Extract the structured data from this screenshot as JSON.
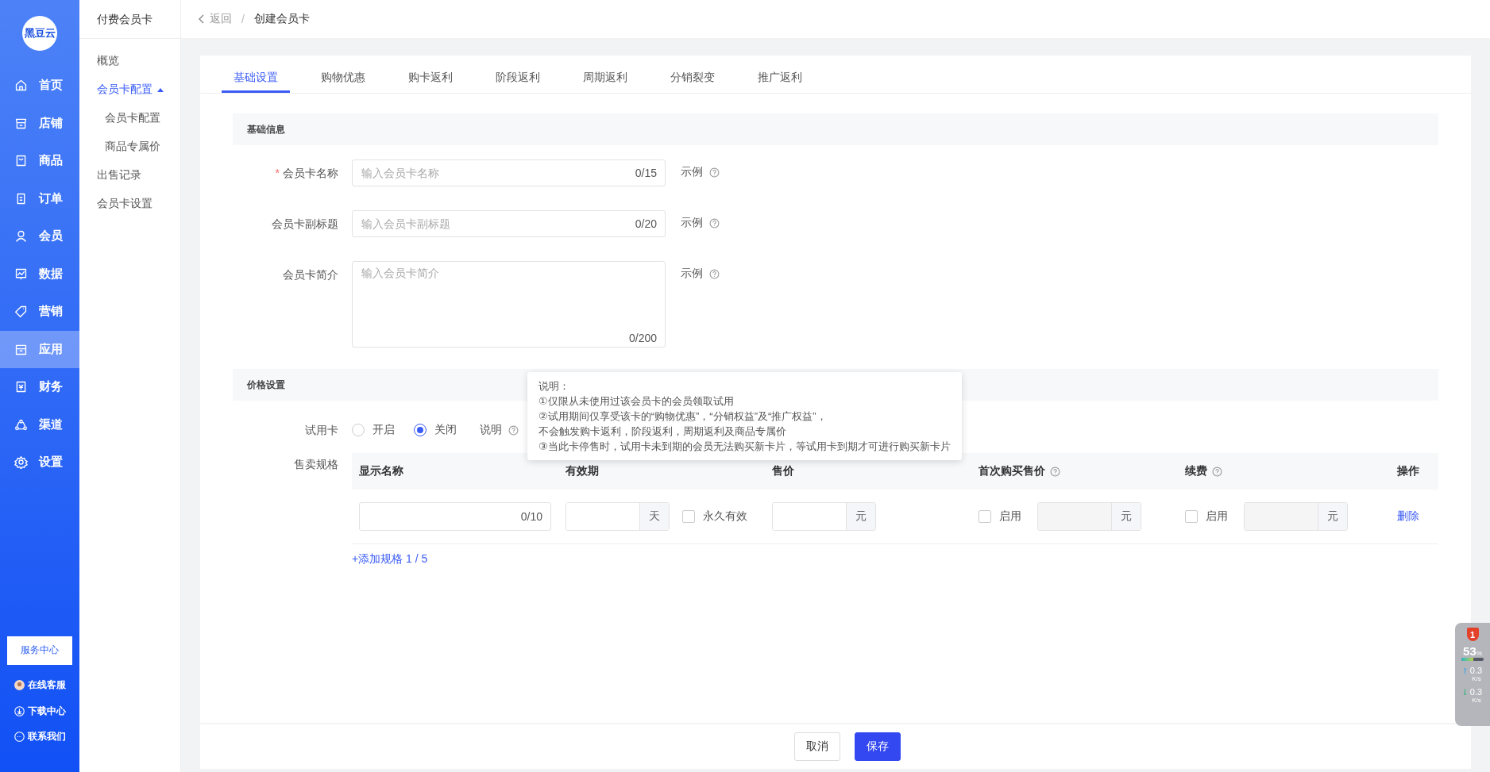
{
  "sidebar": {
    "logo": "黑豆云",
    "items": [
      {
        "label": "首页",
        "selected": false
      },
      {
        "label": "店铺",
        "selected": false
      },
      {
        "label": "商品",
        "selected": false
      },
      {
        "label": "订单",
        "selected": false
      },
      {
        "label": "会员",
        "selected": false
      },
      {
        "label": "数据",
        "selected": false
      },
      {
        "label": "营销",
        "selected": false
      },
      {
        "label": "应用",
        "selected": true
      },
      {
        "label": "财务",
        "selected": false
      },
      {
        "label": "渠道",
        "selected": false
      },
      {
        "label": "设置",
        "selected": false
      }
    ],
    "service_button": "服务中心",
    "links": [
      "在线客服",
      "下载中心",
      "联系我们"
    ]
  },
  "subnav": {
    "title": "付费会员卡",
    "items": [
      {
        "label": "概览",
        "selected": false
      },
      {
        "label": "会员卡配置",
        "selected": true,
        "expanded": true,
        "children": [
          {
            "label": "会员卡配置",
            "selected": false
          },
          {
            "label": "商品专属价",
            "selected": false
          }
        ]
      },
      {
        "label": "出售记录",
        "selected": false
      },
      {
        "label": "会员卡设置",
        "selected": false
      }
    ]
  },
  "breadcrumb": {
    "back": "返回",
    "separator": "/",
    "current": "创建会员卡"
  },
  "tabs": [
    {
      "label": "基础设置",
      "selected": true
    },
    {
      "label": "购物优惠",
      "selected": false
    },
    {
      "label": "购卡返利",
      "selected": false
    },
    {
      "label": "阶段返利",
      "selected": false
    },
    {
      "label": "周期返利",
      "selected": false
    },
    {
      "label": "分销裂变",
      "selected": false
    },
    {
      "label": "推广返利",
      "selected": false
    }
  ],
  "basic_info": {
    "title": "基础信息",
    "required_mark": "*",
    "fields": [
      {
        "kind": "input",
        "label": "会员卡名称",
        "required": true,
        "placeholder": "输入会员卡名称",
        "counter": "0/15",
        "example": "示例"
      },
      {
        "kind": "input",
        "label": "会员卡副标题",
        "required": false,
        "placeholder": "输入会员卡副标题",
        "counter": "0/20",
        "example": "示例"
      },
      {
        "kind": "textarea",
        "label": "会员卡简介",
        "required": false,
        "placeholder": "输入会员卡简介",
        "counter": "0/200",
        "example": "示例"
      }
    ]
  },
  "price": {
    "title": "价格设置",
    "trial": {
      "label": "试用卡",
      "options": [
        {
          "label": "开启",
          "selected": false
        },
        {
          "label": "关闭",
          "selected": true
        }
      ],
      "note": "说明"
    },
    "tooltip": {
      "title": "说明：",
      "lines": [
        "①仅限从未使用过该会员卡的会员领取试用",
        "②试用期间仅享受该卡的“购物优惠”，“分销权益”及“推广权益”，",
        "不会触发购卡返利，阶段返利，周期返利及商品专属价",
        "③当此卡停售时，试用卡未到期的会员无法购买新卡片，等试用卡到期才可进行购买新卡片"
      ]
    },
    "spec": {
      "label": "售卖规格",
      "columns": [
        {
          "label": "显示名称",
          "help": false
        },
        {
          "label": "有效期",
          "help": false
        },
        {
          "label": "售价",
          "help": false
        },
        {
          "label": "首次购买售价",
          "help": true
        },
        {
          "label": "续费",
          "help": true
        },
        {
          "label": "操作",
          "help": false
        }
      ],
      "row": {
        "name_counter": "0/10",
        "validity_unit": "天",
        "permanent": {
          "label": "永久有效",
          "checked": false
        },
        "price_unit": "元",
        "first_price": {
          "label": "启用",
          "checked": false,
          "unit": "元"
        },
        "renewal": {
          "label": "启用",
          "checked": false,
          "unit": "元"
        },
        "action": "删除"
      },
      "add": "+添加规格 1 / 5"
    }
  },
  "footer": {
    "cancel": "取消",
    "save": "保存"
  },
  "monitor": {
    "badge": "1",
    "percent": "53",
    "percent_unit": "%",
    "level": 0.53,
    "up": "0.3",
    "up_unit": "K/s",
    "down": "0.3",
    "down_unit": "K/s"
  }
}
